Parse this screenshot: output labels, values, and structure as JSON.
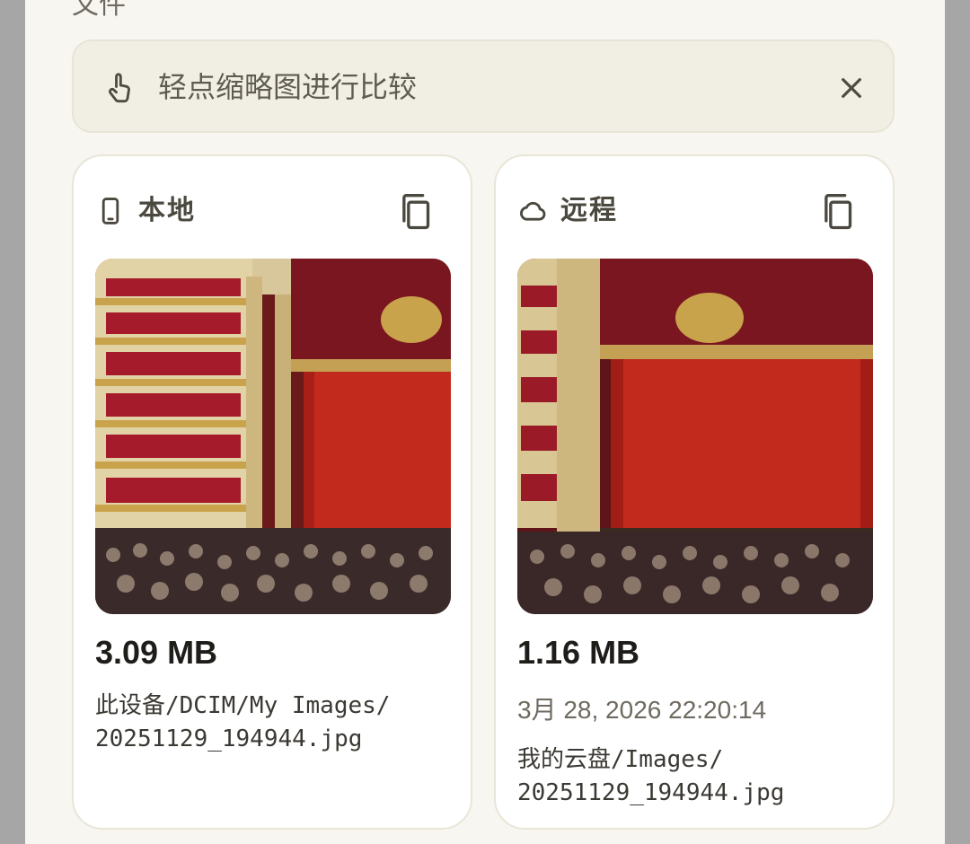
{
  "section": {
    "label": "文件"
  },
  "hint": {
    "text": "轻点缩略图进行比较",
    "icon": "touch-icon",
    "close_icon": "close-icon"
  },
  "local": {
    "title": "本地",
    "icon": "phone-icon",
    "copy_icon": "copy-icon",
    "size": "3.09 MB",
    "path_line1": "此设备/DCIM/My Images/",
    "path_line2": "20251129_194944.jpg"
  },
  "remote": {
    "title": "远程",
    "icon": "cloud-icon",
    "copy_icon": "copy-icon",
    "size": "1.16 MB",
    "date": "3月 28, 2026 22:20:14",
    "path_line1": "我的云盘/Images/",
    "path_line2": "20251129_194944.jpg"
  },
  "colors": {
    "background": "#f8f6f0",
    "hint_background": "#f1eee4",
    "card_background": "#ffffff",
    "curtain_red": "#c22a1e",
    "gold": "#c9a24c"
  }
}
